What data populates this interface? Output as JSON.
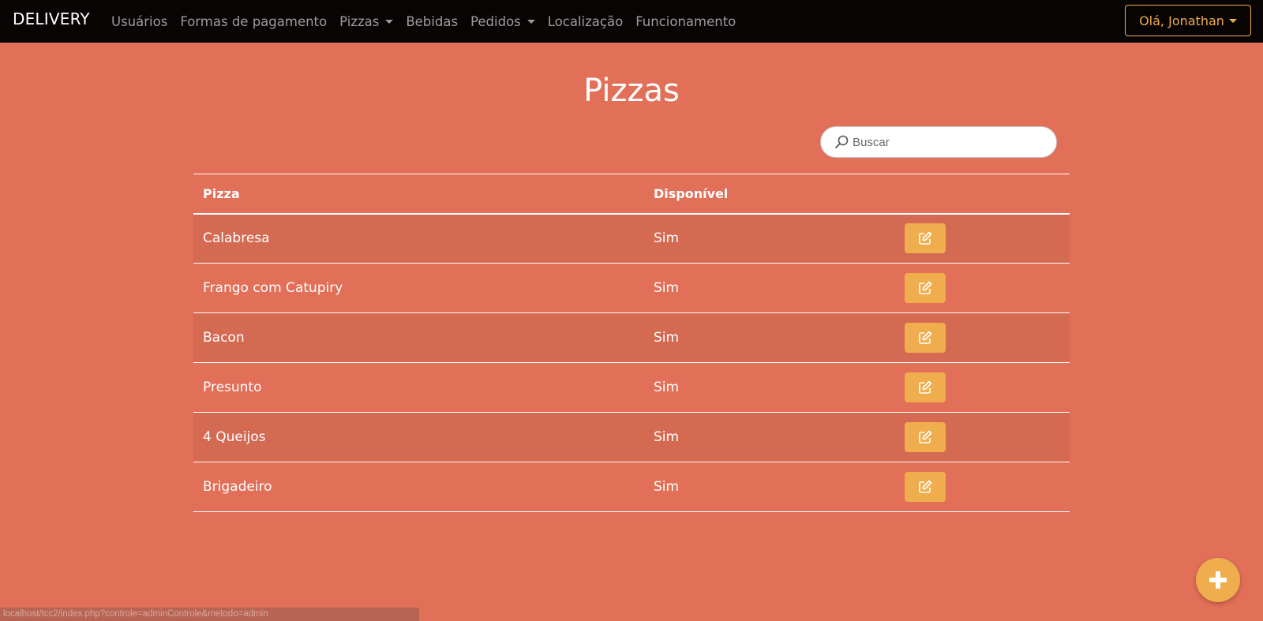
{
  "navbar": {
    "brand": "DELIVERY",
    "links": [
      {
        "label": "Usuários",
        "dropdown": false
      },
      {
        "label": "Formas de pagamento",
        "dropdown": false
      },
      {
        "label": "Pizzas",
        "dropdown": true
      },
      {
        "label": "Bebidas",
        "dropdown": false
      },
      {
        "label": "Pedidos",
        "dropdown": true
      },
      {
        "label": "Localização",
        "dropdown": false
      },
      {
        "label": "Funcionamento",
        "dropdown": false
      }
    ],
    "user_label": "Olá, Jonathan"
  },
  "page": {
    "title": "Pizzas"
  },
  "search": {
    "placeholder": "Buscar",
    "value": ""
  },
  "table": {
    "headers": [
      "Pizza",
      "Disponível",
      ""
    ],
    "rows": [
      {
        "name": "Calabresa",
        "available": "Sim"
      },
      {
        "name": "Frango com Catupiry",
        "available": "Sim"
      },
      {
        "name": "Bacon",
        "available": "Sim"
      },
      {
        "name": "Presunto",
        "available": "Sim"
      },
      {
        "name": "4 Queijos",
        "available": "Sim"
      },
      {
        "name": "Brigadeiro",
        "available": "Sim"
      }
    ],
    "row_action_icon": "edit-icon"
  },
  "fab": {
    "icon": "plus-icon"
  },
  "status_bar": {
    "url": "localhost/tcc2/index.php?controle=adminControle&metodo=admin"
  },
  "colors": {
    "background": "#e26f58",
    "navbar": "#070403",
    "accent": "#f0ad4e",
    "striped_row": "#d56a53"
  }
}
